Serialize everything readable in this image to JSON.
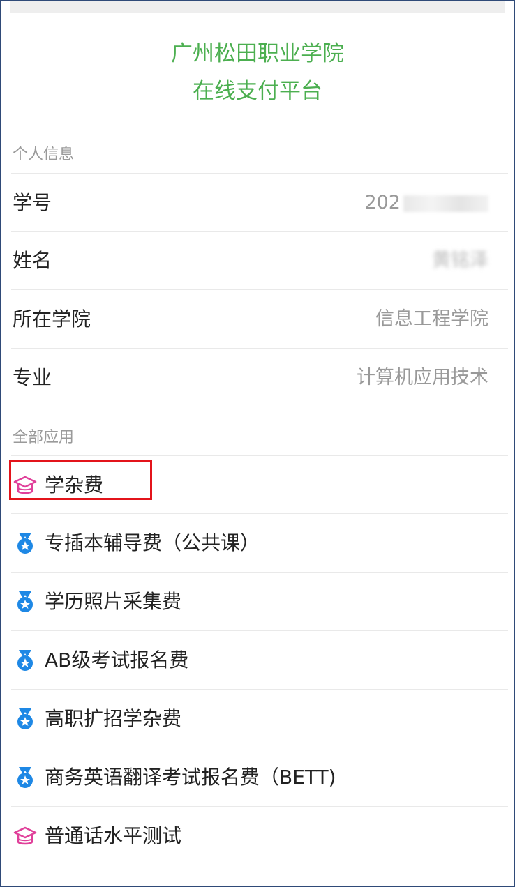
{
  "header": {
    "line1": "广州松田职业学院",
    "line2": "在线支付平台"
  },
  "personal": {
    "section_title": "个人信息",
    "rows": [
      {
        "label": "学号",
        "value": "202"
      },
      {
        "label": "姓名",
        "value": "黄铭泽"
      },
      {
        "label": "所在学院",
        "value": "信息工程学院"
      },
      {
        "label": "专业",
        "value": "计算机应用技术"
      }
    ]
  },
  "apps": {
    "section_title": "全部应用",
    "items": [
      {
        "label": "学杂费",
        "icon": "graduation-cap-icon"
      },
      {
        "label": "专插本辅导费（公共课）",
        "icon": "medal-icon"
      },
      {
        "label": "学历照片采集费",
        "icon": "medal-icon"
      },
      {
        "label": "AB级考试报名费",
        "icon": "medal-icon"
      },
      {
        "label": "高职扩招学杂费",
        "icon": "medal-icon"
      },
      {
        "label": "商务英语翻译考试报名费（BETT)",
        "icon": "medal-icon"
      },
      {
        "label": "普通话水平测试",
        "icon": "graduation-cap-icon"
      }
    ]
  },
  "colors": {
    "header_green": "#4caf50",
    "cap_pink": "#e0409a",
    "medal_blue": "#1e88e5",
    "highlight_red": "#e3141b",
    "frame_border": "#2f4a78"
  }
}
